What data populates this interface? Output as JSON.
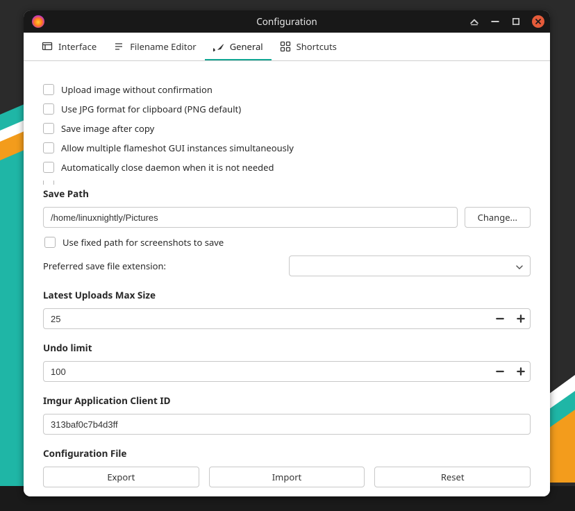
{
  "window": {
    "title": "Configuration"
  },
  "tabs": {
    "items": [
      {
        "label": "Interface"
      },
      {
        "label": "Filename Editor"
      },
      {
        "label": "General"
      },
      {
        "label": "Shortcuts"
      }
    ],
    "active_index": 2
  },
  "checkboxes": [
    {
      "label": "Upload image without confirmation",
      "checked": false
    },
    {
      "label": "Use JPG format for clipboard (PNG default)",
      "checked": false
    },
    {
      "label": "Save image after copy",
      "checked": false
    },
    {
      "label": "Allow multiple flameshot GUI instances simultaneously",
      "checked": false
    },
    {
      "label": "Automatically close daemon when it is not needed",
      "checked": false
    }
  ],
  "save_path": {
    "heading": "Save Path",
    "value": "/home/linuxnightly/Pictures",
    "change_label": "Change...",
    "use_fixed_label": "Use fixed path for screenshots to save",
    "use_fixed_checked": false,
    "pref_ext_label": "Preferred save file extension:",
    "pref_ext_value": ""
  },
  "latest_uploads": {
    "heading": "Latest Uploads Max Size",
    "value": "25"
  },
  "undo_limit": {
    "heading": "Undo limit",
    "value": "100"
  },
  "imgur": {
    "heading": "Imgur Application Client ID",
    "value": "313baf0c7b4d3ff"
  },
  "config_file": {
    "heading": "Configuration File",
    "export_label": "Export",
    "import_label": "Import",
    "reset_label": "Reset"
  }
}
